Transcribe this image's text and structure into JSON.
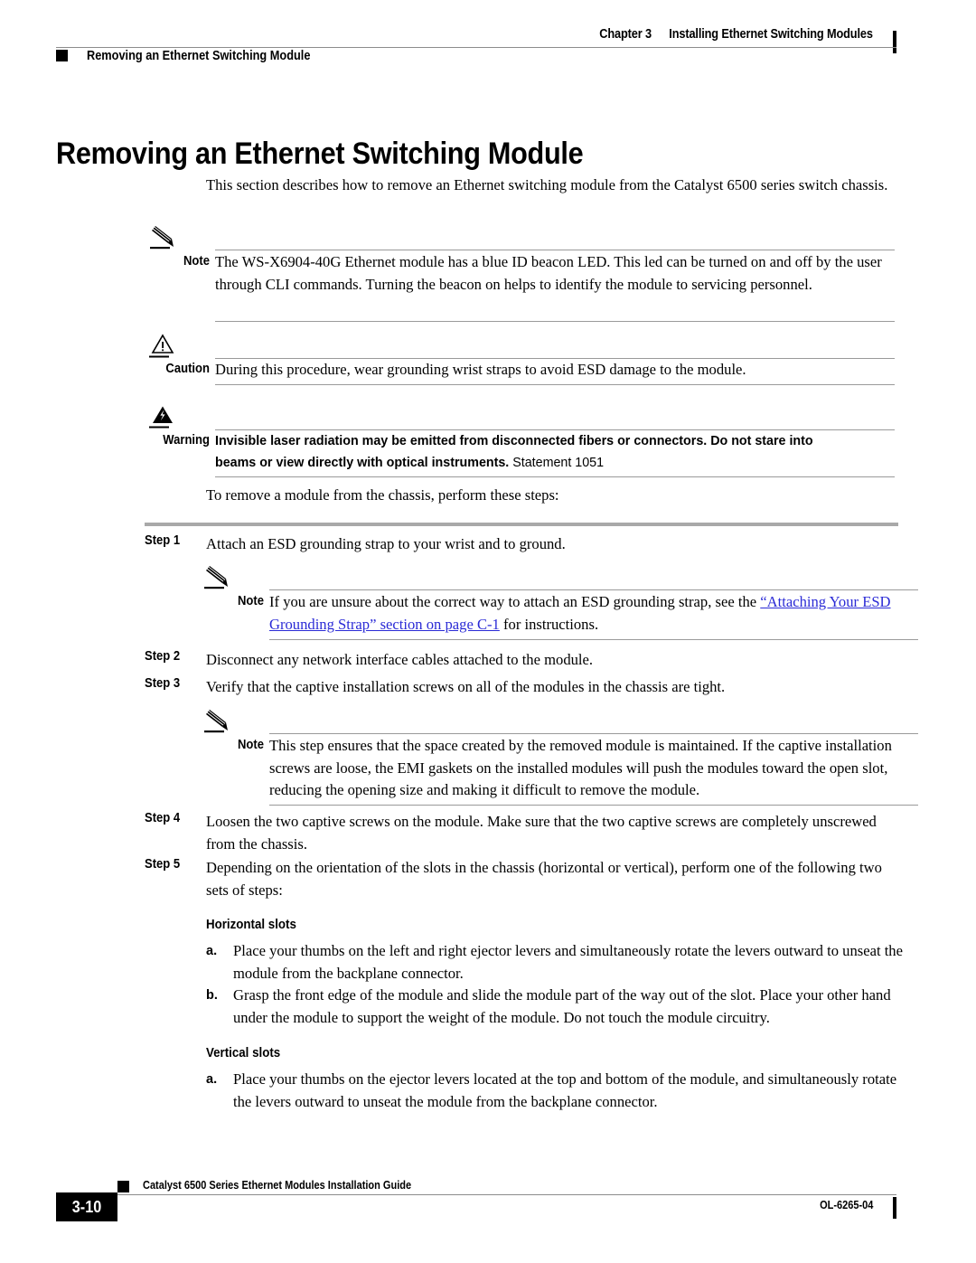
{
  "header": {
    "chapter_number": "Chapter 3",
    "chapter_title": "Installing Ethernet Switching Modules",
    "section_title": "Removing an Ethernet Switching Module"
  },
  "page_title": "Removing an Ethernet Switching Module",
  "intro": "This section describes how to remove an Ethernet switching module from the Catalyst 6500 series switch chassis.",
  "note_1": {
    "label": "Note",
    "text": "The WS-X6904-40G Ethernet module has a blue ID beacon LED. This led can be turned on and off by the user through CLI commands. Turning the beacon on helps to identify the module to servicing personnel."
  },
  "caution": {
    "label": "Caution",
    "text": "During this procedure, wear grounding wrist straps to avoid ESD damage to the module."
  },
  "warning": {
    "label": "Warning",
    "text": "Invisible laser radiation may be emitted from disconnected fibers or connectors. Do not stare into beams or view directly with optical instruments.",
    "statement": "Statement 1051"
  },
  "lead_in": "To remove a module from the chassis, perform these steps:",
  "steps": [
    {
      "label": "Step 1",
      "text": "Attach an ESD grounding strap to your wrist and to ground."
    },
    {
      "label": "Step 2",
      "text": "Disconnect any network interface cables attached to the module."
    },
    {
      "label": "Step 3",
      "text": "Verify that the captive installation screws on all of the modules in the chassis are tight."
    },
    {
      "label": "Step 4",
      "text": "Loosen the two captive screws on the module. Make sure that the two captive screws are completely unscrewed from the chassis."
    },
    {
      "label": "Step 5",
      "text": "Depending on the orientation of the slots in the chassis (horizontal or vertical), perform one of the following two sets of steps:"
    }
  ],
  "note_2": {
    "label": "Note",
    "text_before_link": "If you are unsure about the correct way to attach an ESD grounding strap, see the ",
    "link_text": "“Attaching Your ESD Grounding Strap” section on page C-1",
    "text_after_link": " for instructions."
  },
  "note_3": {
    "label": "Note",
    "text": "This step ensures that the space created by the removed module is maintained. If the captive installation screws are loose, the EMI gaskets on the installed modules will push the modules toward the open slot, reducing the opening size and making it difficult to remove the module."
  },
  "horizontal_slots": {
    "heading": "Horizontal slots",
    "items": [
      {
        "label": "a.",
        "text": "Place your thumbs on the left and right ejector levers and simultaneously rotate the levers outward to unseat the module from the backplane connector."
      },
      {
        "label": "b.",
        "text": "Grasp the front edge of the module and slide the module part of the way out of the slot. Place your other hand under the module to support the weight of the module. Do not touch the module circuitry."
      }
    ]
  },
  "vertical_slots": {
    "heading": "Vertical slots",
    "items": [
      {
        "label": "a.",
        "text": "Place your thumbs on the ejector levers located at the top and bottom of the module, and simultaneously rotate the levers outward to unseat the module from the backplane connector."
      }
    ]
  },
  "footer": {
    "guide_title": "Catalyst 6500 Series Ethernet Modules Installation Guide",
    "page_number": "3-10",
    "doc_id": "OL-6265-04"
  },
  "colors": {
    "link": "#2b2bd6",
    "rule": "#8c8c8c",
    "step_rule": "#a9a9a9",
    "text": "#000000"
  }
}
